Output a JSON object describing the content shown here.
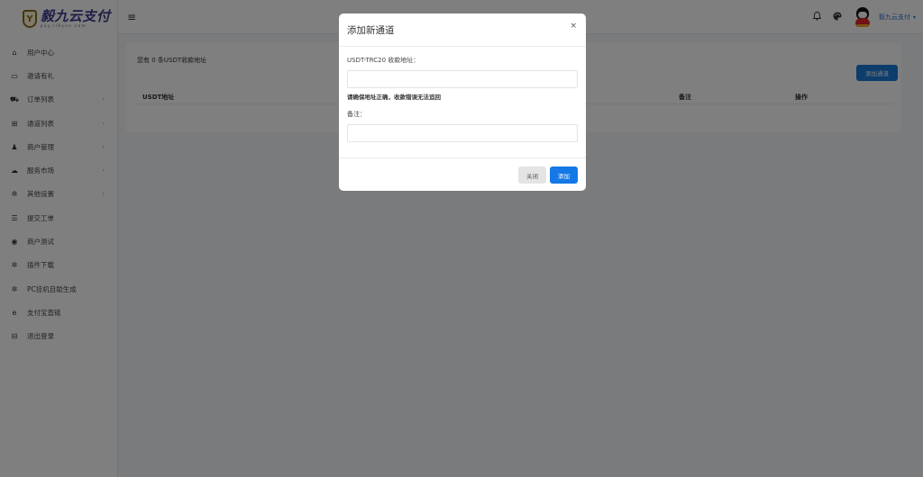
{
  "app": {
    "logo_text": "毅九云支付",
    "logo_sub": "pay.ll9yun.com",
    "logo_badge": "Y"
  },
  "sidebar": {
    "items": [
      {
        "label": "用户中心",
        "icon": "home-icon",
        "glyph": "⌂",
        "has_arrow": false
      },
      {
        "label": "邀请有礼",
        "icon": "monitor-icon",
        "glyph": "▭",
        "has_arrow": false
      },
      {
        "label": "订单列表",
        "icon": "cart-icon",
        "glyph": "⛟",
        "has_arrow": true
      },
      {
        "label": "通道列表",
        "icon": "grid-icon",
        "glyph": "⊞",
        "has_arrow": true
      },
      {
        "label": "商户管理",
        "icon": "user-icon",
        "glyph": "♟",
        "has_arrow": true
      },
      {
        "label": "服务市场",
        "icon": "cloud-icon",
        "glyph": "☁",
        "has_arrow": true
      },
      {
        "label": "其他设置",
        "icon": "gear-icon",
        "glyph": "✲",
        "has_arrow": true
      },
      {
        "label": "提交工单",
        "icon": "chat-icon",
        "glyph": "☰",
        "has_arrow": false
      },
      {
        "label": "商户测试",
        "icon": "compass-icon",
        "glyph": "◉",
        "has_arrow": false
      },
      {
        "label": "插件下载",
        "icon": "gear-icon",
        "glyph": "✲",
        "has_arrow": false
      },
      {
        "label": "PC挂机自助生成",
        "icon": "gear-icon",
        "glyph": "✲",
        "has_arrow": false
      },
      {
        "label": "支付宝直链",
        "icon": "browser-e-icon",
        "glyph": "e",
        "has_arrow": false
      },
      {
        "label": "退出登录",
        "icon": "logout-icon",
        "glyph": "⊟",
        "has_arrow": false
      }
    ],
    "arrow_glyph": "›"
  },
  "topbar": {
    "menu_glyph": "≡",
    "bell_glyph": "🔔",
    "palette_glyph": "◕",
    "user_name": "毅九云支付",
    "caret": "▾"
  },
  "card": {
    "summary": "您有 0 条USDT收款地址",
    "add_button": "添加通道",
    "columns": [
      "USDT地址",
      "备注",
      "操作"
    ]
  },
  "modal": {
    "title": "添加新通道",
    "close_glyph": "×",
    "address_label": "USDT-TRC20 收款地址：",
    "address_value": "",
    "address_help": "请确保地址正确，收款错误无法追回",
    "remark_label": "备注：",
    "remark_value": "",
    "cancel_label": "关闭",
    "submit_label": "添加"
  },
  "colors": {
    "primary": "#1479e6",
    "logo": "#3b3a8f",
    "overlay": "rgba(0,0,0,0.5)"
  }
}
